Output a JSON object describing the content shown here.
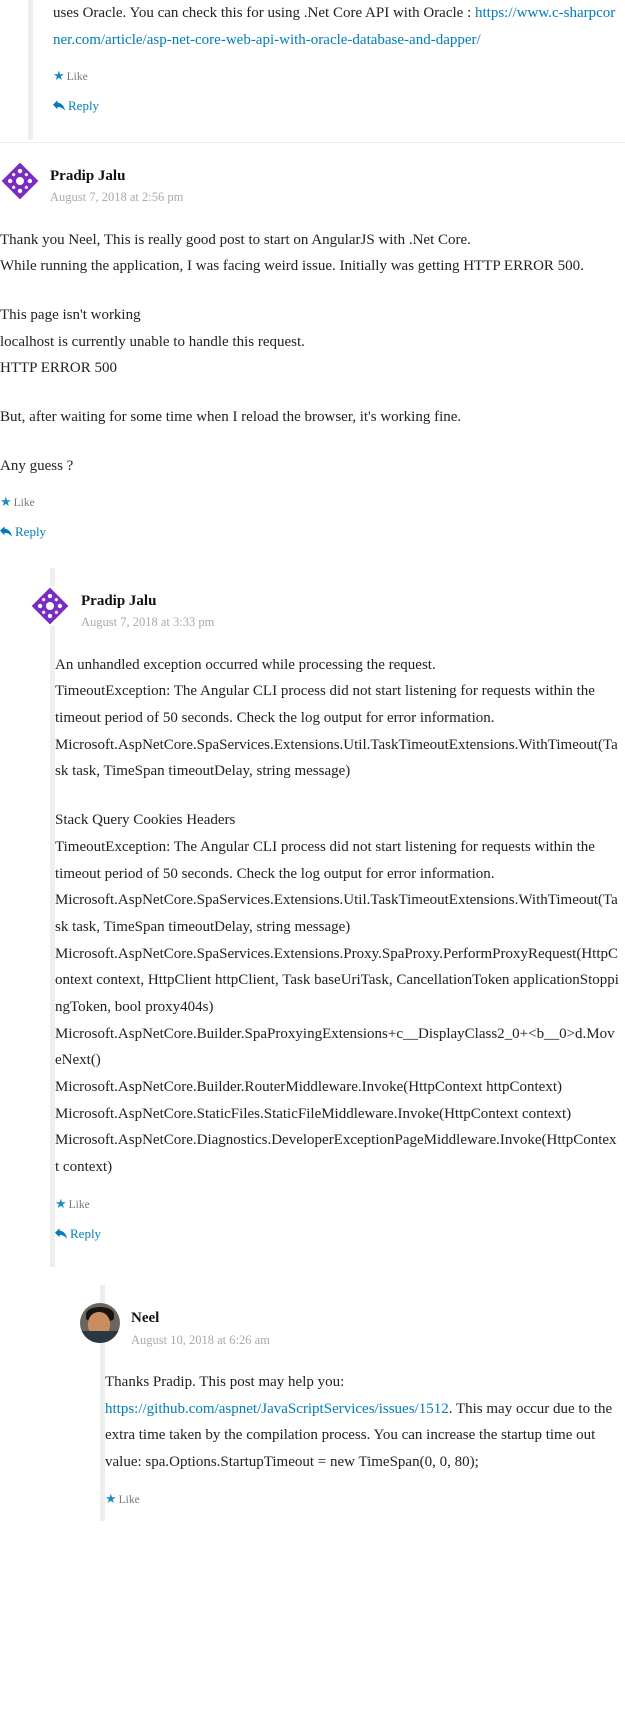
{
  "labels": {
    "like": "Like",
    "reply": "Reply"
  },
  "comments": {
    "c1_partial": {
      "body_line1": "uses Oracle. You can check this for using .Net Core API with Oracle : ",
      "link_text": "https://www.c-sharpcorner.com/article/asp-net-core-web-api-with-oracle-database-and-dapper/"
    },
    "c2": {
      "author": "Pradip Jalu",
      "date": "August 7, 2018 at 2:56 pm",
      "p1": "Thank you Neel, This is really good post to start on AngularJS with .Net Core.",
      "p2": "While running the application, I was facing weird issue. Initially was getting HTTP ERROR 500.",
      "p3": "This page isn't working",
      "p4": "localhost is currently unable to handle this request.",
      "p5": "HTTP ERROR 500",
      "p6": "But, after waiting for some time when I reload the browser, it's working fine.",
      "p7": "Any guess ?"
    },
    "c3": {
      "author": "Pradip Jalu",
      "date": "August 7, 2018 at 3:33 pm",
      "p1": "An unhandled exception occurred while processing the request.",
      "p2": "TimeoutException: The Angular CLI process did not start listening for requests within the timeout period of 50 seconds. Check the log output for error information.",
      "p3": "Microsoft.AspNetCore.SpaServices.Extensions.Util.TaskTimeoutExtensions.WithTimeout(Task task, TimeSpan timeoutDelay, string message)",
      "p4": "Stack Query Cookies Headers",
      "p5": "TimeoutException: The Angular CLI process did not start listening for requests within the timeout period of 50 seconds. Check the log output for error information.",
      "p6": "Microsoft.AspNetCore.SpaServices.Extensions.Util.TaskTimeoutExtensions.WithTimeout(Task task, TimeSpan timeoutDelay, string message)",
      "p7": "Microsoft.AspNetCore.SpaServices.Extensions.Proxy.SpaProxy.PerformProxyRequest(HttpContext context, HttpClient httpClient, Task baseUriTask, CancellationToken applicationStoppingToken, bool proxy404s)",
      "p8": "Microsoft.AspNetCore.Builder.SpaProxyingExtensions+c__DisplayClass2_0+<b__0>d.MoveNext()",
      "p9": "Microsoft.AspNetCore.Builder.RouterMiddleware.Invoke(HttpContext httpContext)",
      "p10": "Microsoft.AspNetCore.StaticFiles.StaticFileMiddleware.Invoke(HttpContext context)",
      "p11": "Microsoft.AspNetCore.Diagnostics.DeveloperExceptionPageMiddleware.Invoke(HttpContext context)"
    },
    "c4": {
      "author": "Neel",
      "date": "August 10, 2018 at 6:26 am",
      "p1a": "Thanks Pradip. This post may help you: ",
      "link_text": "https://github.com/aspnet/JavaScriptServices/issues/1512",
      "p1b": ". This may occur due to the extra time taken by the compilation process. You can increase the startup time out value: spa.Options.StartupTimeout = new TimeSpan(0, 0, 80);"
    }
  }
}
